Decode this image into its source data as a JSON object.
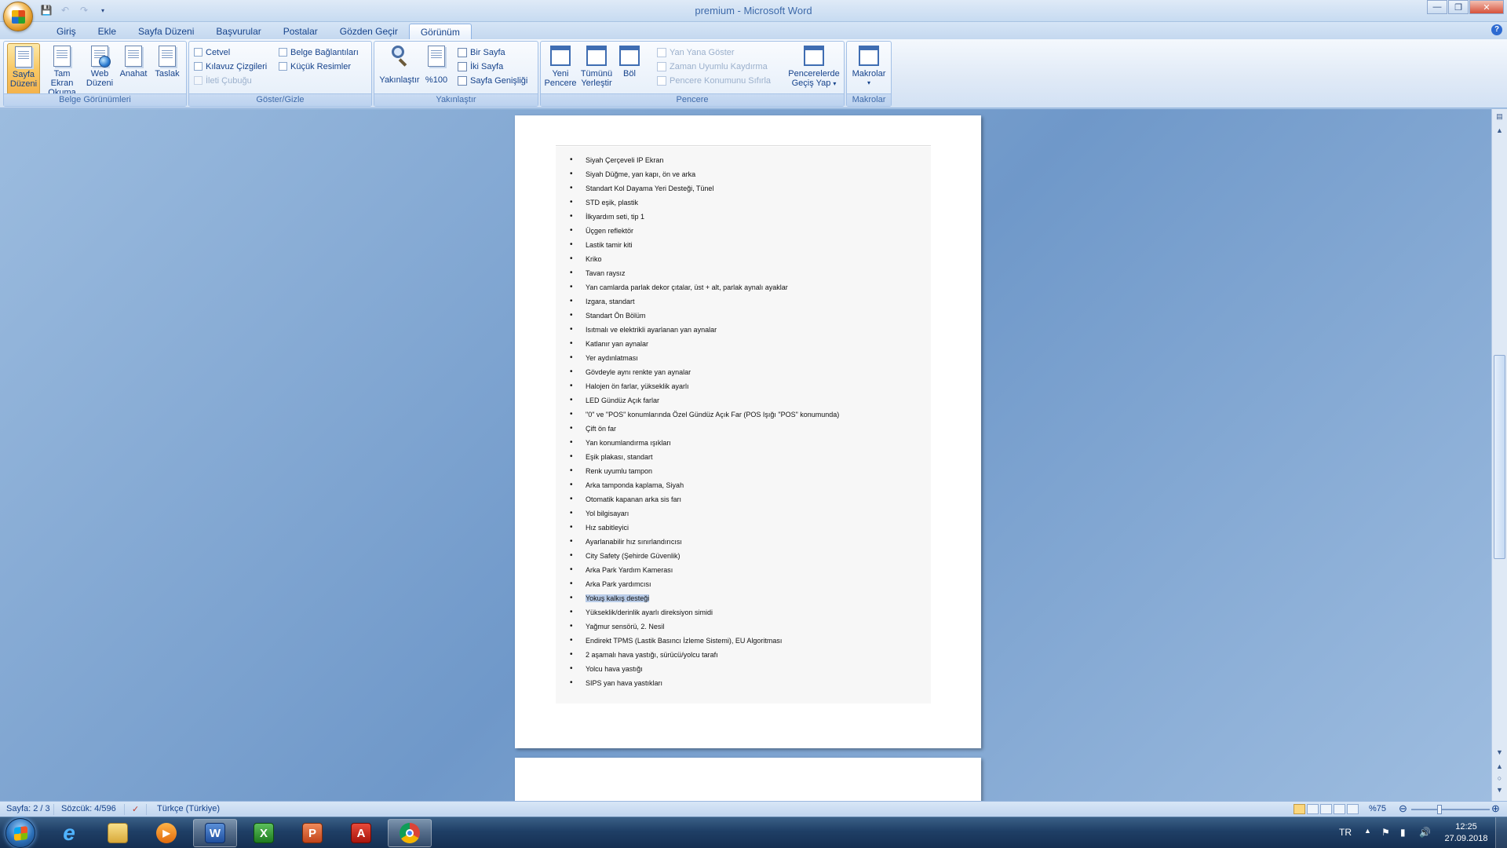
{
  "window": {
    "title": "premium - Microsoft Word"
  },
  "quick_access": {
    "icons": [
      "save-icon",
      "undo-icon",
      "redo-icon",
      "customize-icon"
    ]
  },
  "tabs": [
    {
      "label": "Giriş"
    },
    {
      "label": "Ekle"
    },
    {
      "label": "Sayfa Düzeni"
    },
    {
      "label": "Başvurular"
    },
    {
      "label": "Postalar"
    },
    {
      "label": "Gözden Geçir"
    },
    {
      "label": "Görünüm",
      "active": true
    }
  ],
  "ribbon": {
    "belge": {
      "label": "Belge Görünümleri",
      "sayfa_duzeni": [
        "Sayfa",
        "Düzeni"
      ],
      "tam_ekran": [
        "Tam Ekran",
        "Okuma"
      ],
      "web_duzeni": [
        "Web",
        "Düzeni"
      ],
      "anahat": "Anahat",
      "taslak": "Taslak"
    },
    "goster": {
      "label": "Göster/Gizle",
      "cetvel": "Cetvel",
      "kilavuz": "Kılavuz Çizgileri",
      "ileti": "İleti Çubuğu",
      "belge_baglantilari": "Belge Bağlantıları",
      "kucuk_resimler": "Küçük Resimler"
    },
    "yakinlastir": {
      "label": "Yakınlaştır",
      "yakinlastir": "Yakınlaştır",
      "yuzde100": "%100",
      "bir_sayfa": "Bir Sayfa",
      "iki_sayfa": "İki Sayfa",
      "sayfa_genisligi": "Sayfa Genişliği"
    },
    "pencere": {
      "label": "Pencere",
      "yeni": [
        "Yeni",
        "Pencere"
      ],
      "tumunu": [
        "Tümünü",
        "Yerleştir"
      ],
      "bol": "Böl",
      "yan_yana": "Yan Yana Göster",
      "zaman_uyumlu": "Zaman Uyumlu Kaydırma",
      "konum_sifirla": "Pencere Konumunu Sıfırla",
      "gecis": [
        "Pencerelerde",
        "Geçiş Yap"
      ]
    },
    "makrolar": {
      "label": "Makrolar",
      "makrolar": "Makrolar"
    }
  },
  "document": {
    "items": [
      "Siyah Çerçeveli IP Ekran",
      "Siyah Düğme, yan kapı, ön ve arka",
      "Standart Kol Dayama Yeri Desteği, Tünel",
      "STD eşik, plastik",
      "İlkyardım seti, tip 1",
      "Üçgen reflektör",
      "Lastik tamir kiti",
      "Kriko",
      "Tavan raysız",
      "Yan camlarda parlak dekor çıtalar, üst + alt, parlak aynalı ayaklar",
      "Izgara, standart",
      "Standart Ön Bölüm",
      "Isıtmalı ve elektrikli ayarlanan yan aynalar",
      "Katlanır yan aynalar",
      "Yer aydınlatması",
      "Gövdeyle aynı renkte yan aynalar",
      "Halojen ön farlar, yükseklik ayarlı",
      "LED Gündüz Açık farlar",
      "\"0\" ve \"POS\" konumlarında Özel Gündüz Açık Far (POS Işığı \"POS\" konumunda)",
      "Çift ön far",
      "Yan konumlandırma ışıkları",
      "Eşik plakası, standart",
      "Renk uyumlu tampon",
      "Arka tamponda kaplama, Siyah",
      "Otomatik kapanan arka sis farı",
      "Yol bilgisayarı",
      "Hız sabitleyici",
      "Ayarlanabilir hız sınırlandırıcısı",
      "City Safety (Şehirde Güvenlik)",
      "Arka Park Yardım Kamerası",
      "Arka Park yardımcısı",
      "Yokuş kalkış desteği",
      "Yükseklik/derinlik ayarlı direksiyon simidi",
      "Yağmur sensörü, 2. Nesil",
      "Endirekt TPMS (Lastik Basıncı İzleme Sistemi), EU Algoritması",
      "2 aşamalı hava yastığı, sürücü/yolcu tarafı",
      "Yolcu hava yastığı",
      "SIPS yan hava yastıkları"
    ],
    "selected_item": "Yokuş kalkış desteği"
  },
  "statusbar": {
    "page": "Sayfa: 2 / 3",
    "words": "Sözcük: 4/596",
    "language": "Türkçe (Türkiye)",
    "zoom": "%75",
    "zoom_level": 0.75
  },
  "taskbar": {
    "apps": [
      "start-orb",
      "ie-icon",
      "explorer-icon",
      "media-player-icon",
      "word-icon",
      "excel-icon",
      "powerpoint-icon",
      "acrobat-icon",
      "chrome-icon"
    ],
    "active_app": "word-icon",
    "language": "TR",
    "time": "12:25",
    "date": "27.09.2018"
  }
}
